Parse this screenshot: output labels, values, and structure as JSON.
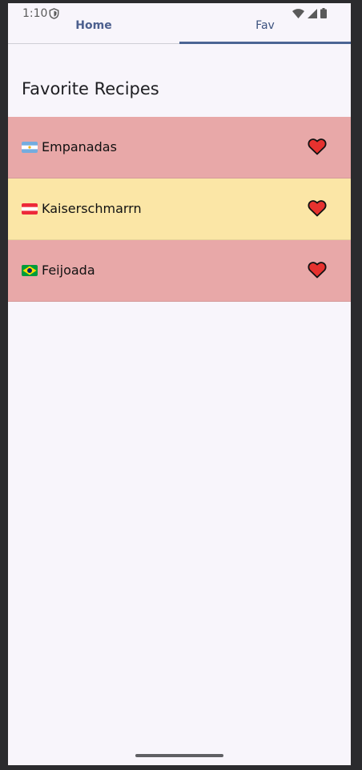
{
  "status": {
    "time": "1:10",
    "icons": [
      "shield-icon",
      "wifi-icon",
      "signal-icon",
      "battery-icon"
    ]
  },
  "tabs": [
    {
      "label": "Home",
      "selected": false
    },
    {
      "label": "Fav",
      "selected": true
    }
  ],
  "page_title": "Favorite Recipes",
  "colors": {
    "accent": "#4b6594",
    "row_red": "#e8a8a8",
    "row_yellow": "#fbe6a6",
    "heart": "#e6322f",
    "background": "#f8f5fb"
  },
  "recipes": [
    {
      "name": "Empanadas",
      "flag": "argentina-flag-icon",
      "favorite": true,
      "row_color": "#e8a8a8"
    },
    {
      "name": "Kaiserschmarrn",
      "flag": "austria-flag-icon",
      "favorite": true,
      "row_color": "#fbe6a6"
    },
    {
      "name": "Feijoada",
      "flag": "brazil-flag-icon",
      "favorite": true,
      "row_color": "#e8a8a8"
    }
  ]
}
